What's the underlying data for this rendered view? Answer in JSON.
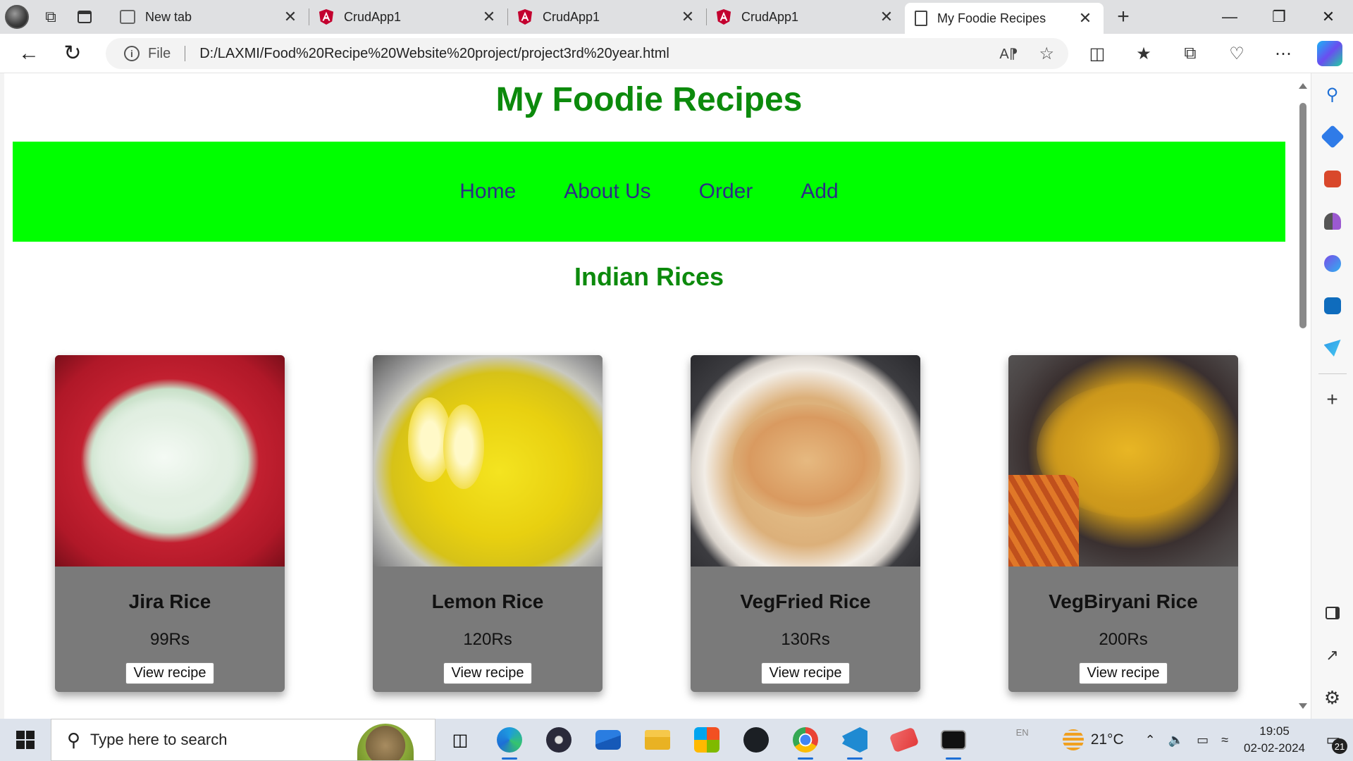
{
  "browser": {
    "tabs": [
      {
        "title": "New tab",
        "icon": "new-tab-icon",
        "active": false
      },
      {
        "title": "CrudApp1",
        "icon": "angular-icon",
        "active": false
      },
      {
        "title": "CrudApp1",
        "icon": "angular-icon",
        "active": false
      },
      {
        "title": "CrudApp1",
        "icon": "angular-icon",
        "active": false
      },
      {
        "title": "My Foodie Recipes",
        "icon": "page-icon",
        "active": true
      }
    ],
    "address": {
      "scheme": "File",
      "url": "D:/LAXMI/Food%20Recipe%20Website%20project/project3rd%20year.html"
    }
  },
  "page": {
    "site_title": "My Foodie Recipes",
    "nav": [
      "Home",
      "About Us",
      "Order",
      "Add"
    ],
    "section_title": "Indian Rices",
    "recipes": [
      {
        "name": "Jira Rice",
        "price": "99Rs",
        "button": "View recipe"
      },
      {
        "name": "Lemon Rice",
        "price": "120Rs",
        "button": "View recipe"
      },
      {
        "name": "VegFried Rice",
        "price": "130Rs",
        "button": "View recipe"
      },
      {
        "name": "VegBiryani Rice",
        "price": "200Rs",
        "button": "View recipe"
      }
    ]
  },
  "taskbar": {
    "search_placeholder": "Type here to search",
    "language": "EN",
    "temperature": "21°C",
    "time": "19:05",
    "date": "02-02-2024",
    "notification_count": "21"
  },
  "colors": {
    "title_green": "#0c8a0c",
    "nav_bg": "#00ff00",
    "nav_link": "#2c2c86",
    "card_bg": "#7a7a7a"
  }
}
